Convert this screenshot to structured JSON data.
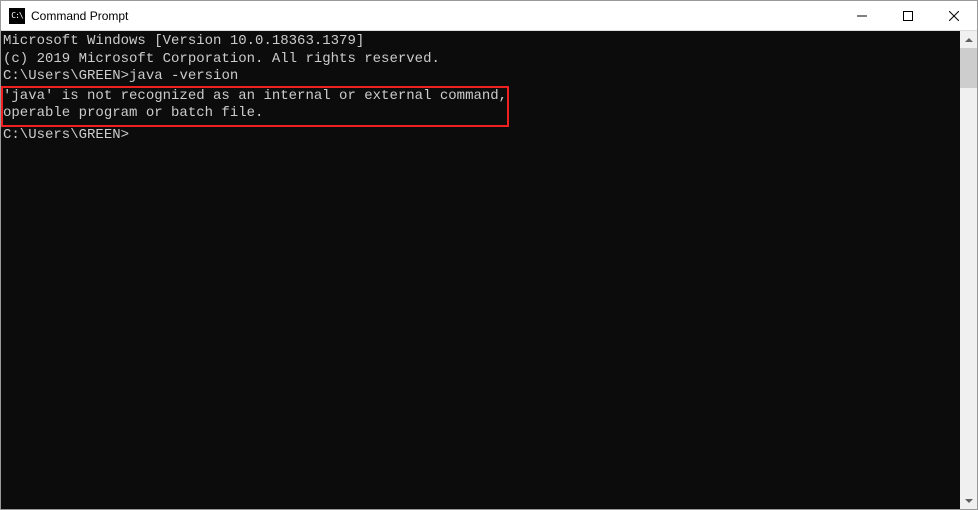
{
  "titlebar": {
    "icon_text": "C:\\",
    "title": "Command Prompt"
  },
  "terminal": {
    "line1": "Microsoft Windows [Version 10.0.18363.1379]",
    "line2": "(c) 2019 Microsoft Corporation. All rights reserved.",
    "blank1": "",
    "prompt1": "C:\\Users\\GREEN>",
    "command1": "java -version",
    "error1": "'java' is not recognized as an internal or external command,",
    "error2": "operable program or batch file.",
    "blank2": "",
    "prompt2": "C:\\Users\\GREEN>"
  }
}
